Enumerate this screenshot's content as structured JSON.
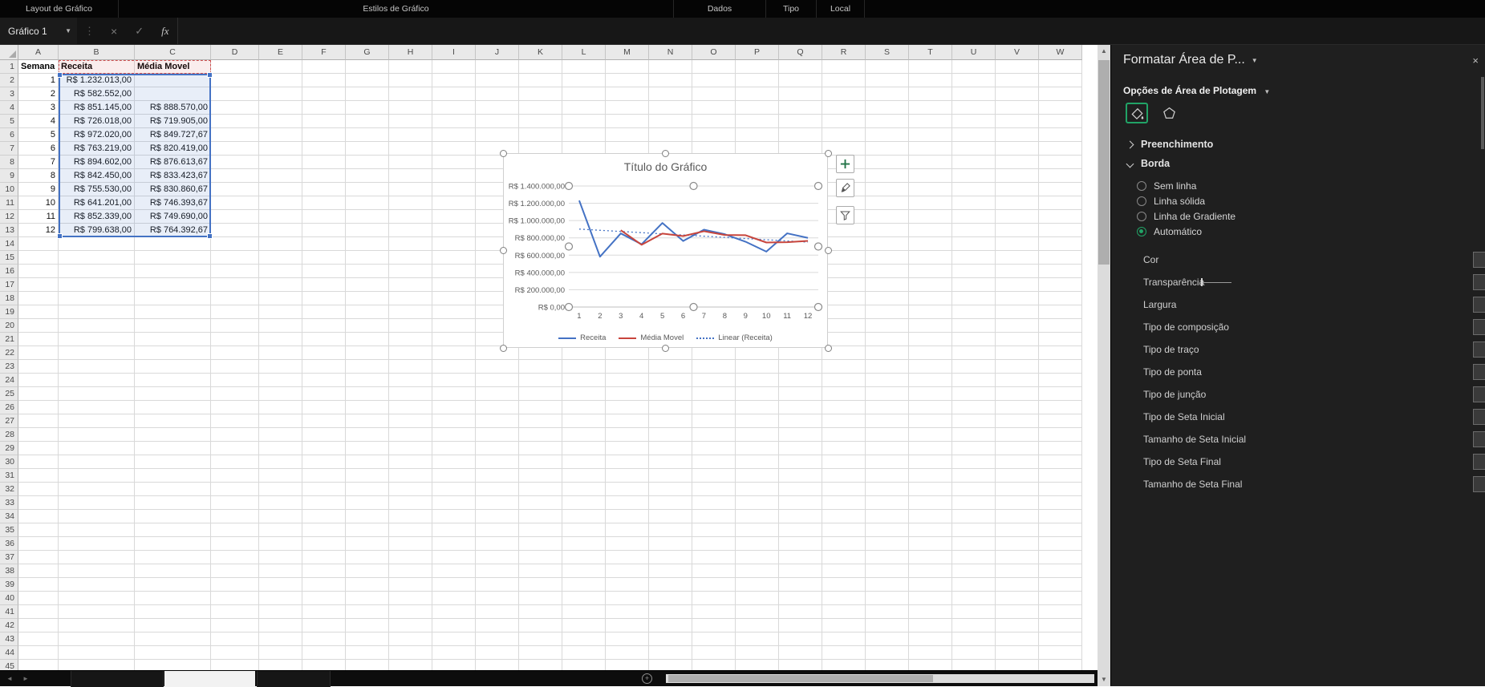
{
  "ribbon": {
    "groups": [
      "Layout de Gráfico",
      "Estilos de Gráfico",
      "Dados",
      "Tipo",
      "Local"
    ]
  },
  "formula_bar": {
    "name_box": "Gráfico 1",
    "fx": "fx",
    "formula": ""
  },
  "sheet": {
    "columns": [
      "A",
      "B",
      "C",
      "D",
      "E",
      "F",
      "G",
      "H",
      "I",
      "J",
      "K",
      "L",
      "M",
      "N",
      "O",
      "P",
      "Q",
      "R",
      "S",
      "T",
      "U",
      "V",
      "W"
    ],
    "row_count": 45,
    "table": {
      "header": [
        "Semana",
        "Receita",
        "Média Movel"
      ],
      "rows": [
        [
          "1",
          "R$ 1.232.013,00",
          ""
        ],
        [
          "2",
          "R$ 582.552,00",
          ""
        ],
        [
          "3",
          "R$ 851.145,00",
          "R$ 888.570,00"
        ],
        [
          "4",
          "R$ 726.018,00",
          "R$ 719.905,00"
        ],
        [
          "5",
          "R$ 972.020,00",
          "R$ 849.727,67"
        ],
        [
          "6",
          "R$ 763.219,00",
          "R$ 820.419,00"
        ],
        [
          "7",
          "R$ 894.602,00",
          "R$ 876.613,67"
        ],
        [
          "8",
          "R$ 842.450,00",
          "R$ 833.423,67"
        ],
        [
          "9",
          "R$ 755.530,00",
          "R$ 830.860,67"
        ],
        [
          "10",
          "R$ 641.201,00",
          "R$ 746.393,67"
        ],
        [
          "11",
          "R$ 852.339,00",
          "R$ 749.690,00"
        ],
        [
          "12",
          "R$ 799.638,00",
          "R$ 764.392,67"
        ]
      ]
    }
  },
  "chart_data": {
    "type": "line",
    "title": "Título do Gráfico",
    "x": [
      "1",
      "2",
      "3",
      "4",
      "5",
      "6",
      "7",
      "8",
      "9",
      "10",
      "11",
      "12"
    ],
    "series": [
      {
        "name": "Receita",
        "color": "#4472c4",
        "values": [
          1232013,
          582552,
          851145,
          726018,
          972020,
          763219,
          894602,
          842450,
          755530,
          641201,
          852339,
          799638
        ]
      },
      {
        "name": "Média Movel",
        "color": "#c8453c",
        "values": [
          null,
          null,
          888570,
          719905,
          849727.67,
          820419,
          876613.67,
          833423.67,
          830860.67,
          746393.67,
          749690,
          764392.67
        ]
      }
    ],
    "trendline": {
      "name": "Linear (Receita)",
      "based_on": "Receita",
      "color": "#4472c4",
      "style": "dotted"
    },
    "ylim": [
      0,
      1400000
    ],
    "y_ticks": [
      0,
      200000,
      400000,
      600000,
      800000,
      1000000,
      1200000,
      1400000
    ],
    "y_tick_labels": [
      "R$ 0,00",
      "R$ 200.000,00",
      "R$ 400.000,00",
      "R$ 600.000,00",
      "R$ 800.000,00",
      "R$ 1.000.000,00",
      "R$ 1.200.000,00",
      "R$ 1.400.000,00"
    ],
    "legend": [
      "Receita",
      "Média Movel",
      "Linear (Receita)"
    ],
    "legend_position": "bottom",
    "grid": true
  },
  "panel": {
    "title": "Formatar Área de P...",
    "options_header": "Opções de Área de Plotagem",
    "icons": [
      {
        "name": "fill-and-line",
        "selected": true
      },
      {
        "name": "effects",
        "selected": false
      }
    ],
    "sections": [
      {
        "label": "Preenchimento",
        "expanded": false
      },
      {
        "label": "Borda",
        "expanded": true
      }
    ],
    "border_options": [
      {
        "label": "Sem linha",
        "selected": false
      },
      {
        "label": "Linha sólida",
        "selected": false
      },
      {
        "label": "Linha de Gradiente",
        "selected": false
      },
      {
        "label": "Automático",
        "selected": true
      }
    ],
    "fields": [
      {
        "label": "Cor",
        "control": "color"
      },
      {
        "label": "Transparência",
        "control": "slider"
      },
      {
        "label": "Largura",
        "control": "spinner"
      },
      {
        "label": "Tipo de composição",
        "control": "dropdown"
      },
      {
        "label": "Tipo de traço",
        "control": "dropdown"
      },
      {
        "label": "Tipo de ponta",
        "control": "dropdown"
      },
      {
        "label": "Tipo de junção",
        "control": "dropdown"
      },
      {
        "label": "Tipo de Seta Inicial",
        "control": "dropdown"
      },
      {
        "label": "Tamanho de Seta Inicial",
        "control": "dropdown"
      },
      {
        "label": "Tipo de Seta Final",
        "control": "dropdown"
      },
      {
        "label": "Tamanho de Seta Final",
        "control": "dropdown"
      }
    ]
  },
  "colors": {
    "accent_green": "#21a366",
    "selection_blue": "#4472c4",
    "series_red": "#c8453c"
  }
}
